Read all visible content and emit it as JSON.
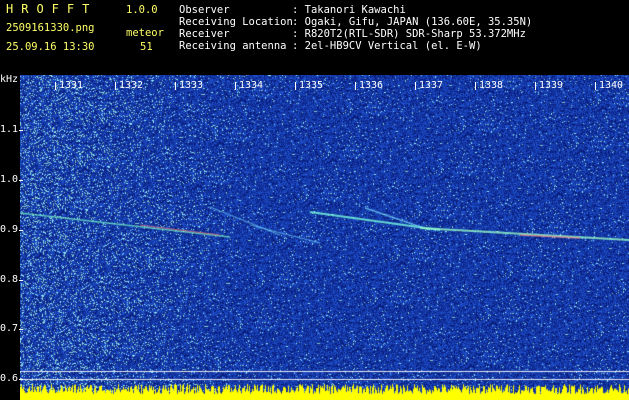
{
  "app": {
    "name": "HROFFT",
    "version": "1.0.0"
  },
  "file": {
    "name": "2509161330.png",
    "datetime": "25.09.16 13:30"
  },
  "detection": {
    "label": "meteor",
    "count": "51"
  },
  "info": [
    {
      "label": "Observer",
      "value": ": Takanori Kawachi"
    },
    {
      "label": "Receiving Location",
      "value": ": Ogaki, Gifu, JAPAN (136.60E, 35.35N)"
    },
    {
      "label": "Receiver",
      "value": ": R820T2(RTL-SDR) SDR-Sharp 53.372MHz"
    },
    {
      "label": "Receiving antenna",
      "value": ": 2el-HB9CV Vertical (el. E-W)"
    }
  ],
  "axis": {
    "y_unit": "kHz",
    "x_ticks": [
      "1331",
      "1332",
      "1333",
      "1334",
      "1335",
      "1336",
      "1337",
      "1338",
      "1339",
      "1340"
    ],
    "y_ticks": [
      "1.1",
      "1.0",
      "0.9",
      "0.8",
      "0.7",
      "0.6"
    ]
  },
  "colors": {
    "noise_bg": "#0a1f8a",
    "trail": "#58e0ff",
    "text_green": "#7CFF7C",
    "text_yellow": "#FFFF66",
    "signal_yellow": "#ffff00"
  }
}
